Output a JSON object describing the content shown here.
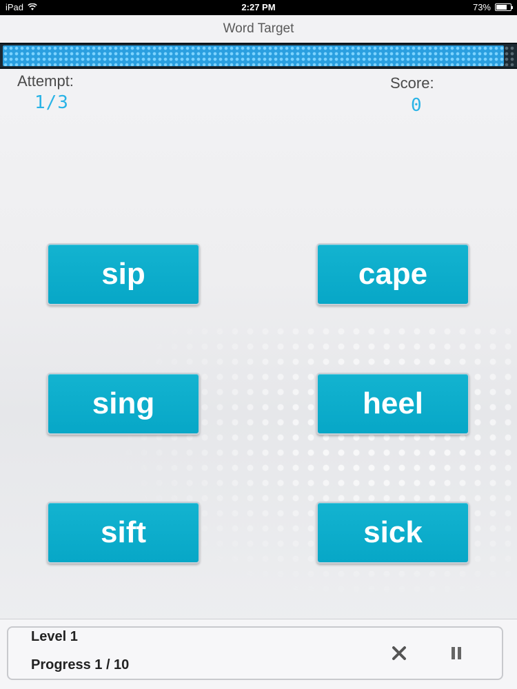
{
  "status_bar": {
    "device": "iPad",
    "time": "2:27 PM",
    "battery": "73%",
    "battery_level": 0.73
  },
  "nav": {
    "title": "Word Target"
  },
  "timer": {
    "remaining_fraction": 0.98
  },
  "stats": {
    "attempt_label": "Attempt:",
    "attempt_value": "1/3",
    "score_label": "Score:",
    "score_value": "0"
  },
  "words": [
    "sip",
    "cape",
    "sing",
    "heel",
    "sift",
    "sick"
  ],
  "footer": {
    "level": "Level 1",
    "progress": "Progress 1 / 10",
    "close_icon": "close-icon",
    "pause_icon": "pause-icon"
  },
  "colors": {
    "button": "#07a7c7",
    "digits": "#29b3e6",
    "timer": "#2a9fe0"
  }
}
